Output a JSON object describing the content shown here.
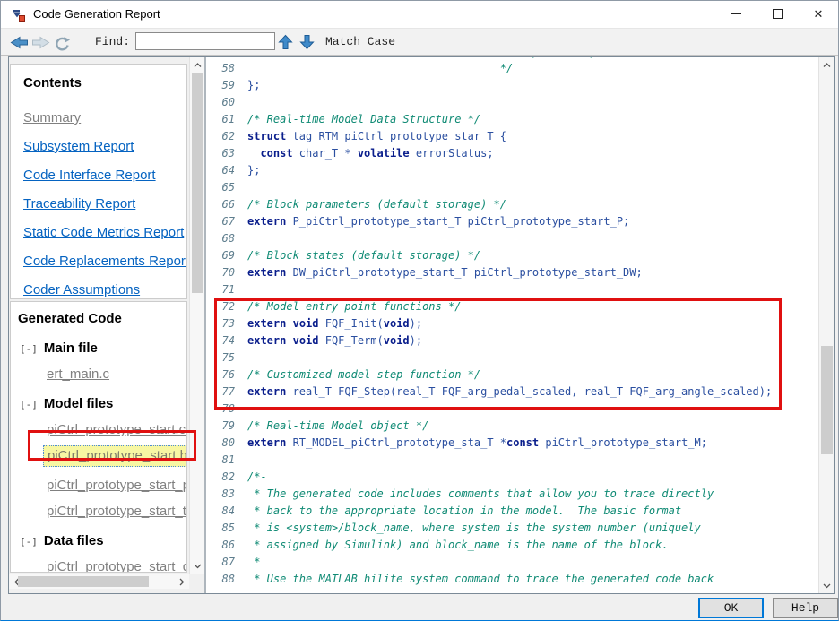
{
  "window": {
    "title": "Code Generation Report"
  },
  "toolbar": {
    "find_label": "Find:",
    "find_value": "",
    "match_case_label": "Match Case"
  },
  "icons": {
    "window_icon": "report-window-icon",
    "back": "back-arrow-icon",
    "forward": "forward-arrow-icon",
    "refresh": "refresh-icon",
    "find_prev": "find-previous-up-arrow-icon",
    "find_next": "find-next-down-arrow-icon",
    "minimize": "minimize-icon",
    "maximize": "maximize-icon",
    "close": "close-icon"
  },
  "sidebar": {
    "contents": {
      "heading": "Contents",
      "links": [
        {
          "label": "Summary",
          "visited": true
        },
        {
          "label": "Subsystem Report",
          "visited": false
        },
        {
          "label": "Code Interface Report",
          "visited": false
        },
        {
          "label": "Traceability Report",
          "visited": false
        },
        {
          "label": "Static Code Metrics Report",
          "visited": false
        },
        {
          "label": "Code Replacements Report",
          "visited": false
        },
        {
          "label": "Coder Assumptions",
          "visited": false
        }
      ]
    },
    "generated_code": {
      "heading": "Generated Code",
      "groups": [
        {
          "expander": "[-]",
          "label": "Main file",
          "files": [
            {
              "label": "ert_main.c",
              "selected": false
            }
          ]
        },
        {
          "expander": "[-]",
          "label": "Model files",
          "files": [
            {
              "label": "piCtrl_prototype_start.c",
              "selected": false
            },
            {
              "label": "piCtrl_prototype_start.h",
              "selected": true,
              "annotated": true
            },
            {
              "label": "piCtrl_prototype_start_pri",
              "selected": false
            },
            {
              "label": "piCtrl_prototype_start_typ",
              "selected": false
            }
          ]
        },
        {
          "expander": "[-]",
          "label": "Data files",
          "files": [
            {
              "label": "piCtrl_prototype_start_da",
              "selected": false
            }
          ]
        }
      ]
    }
  },
  "code": {
    "partial_top_line": "                                            y        y",
    "lines": [
      {
        "n": 58,
        "segments": [
          {
            "s": "c",
            "t": "                                       */"
          }
        ]
      },
      {
        "n": 59,
        "segments": [
          {
            "s": "p",
            "t": "};"
          }
        ]
      },
      {
        "n": 60,
        "segments": []
      },
      {
        "n": 61,
        "segments": [
          {
            "s": "c",
            "t": "/* Real-time Model Data Structure */"
          }
        ]
      },
      {
        "n": 62,
        "segments": [
          {
            "s": "k",
            "t": "struct"
          },
          {
            "s": "p",
            "t": " tag_RTM_piCtrl_prototype_star_T {"
          }
        ]
      },
      {
        "n": 63,
        "segments": [
          {
            "s": "p",
            "t": "  "
          },
          {
            "s": "k",
            "t": "const"
          },
          {
            "s": "p",
            "t": " char_T * "
          },
          {
            "s": "k",
            "t": "volatile"
          },
          {
            "s": "p",
            "t": " errorStatus;"
          }
        ]
      },
      {
        "n": 64,
        "segments": [
          {
            "s": "p",
            "t": "};"
          }
        ]
      },
      {
        "n": 65,
        "segments": []
      },
      {
        "n": 66,
        "segments": [
          {
            "s": "c",
            "t": "/* Block parameters (default storage) */"
          }
        ]
      },
      {
        "n": 67,
        "segments": [
          {
            "s": "k",
            "t": "extern"
          },
          {
            "s": "p",
            "t": " P_piCtrl_prototype_start_T piCtrl_prototype_start_P;"
          }
        ]
      },
      {
        "n": 68,
        "segments": []
      },
      {
        "n": 69,
        "segments": [
          {
            "s": "c",
            "t": "/* Block states (default storage) */"
          }
        ]
      },
      {
        "n": 70,
        "segments": [
          {
            "s": "k",
            "t": "extern"
          },
          {
            "s": "p",
            "t": " DW_piCtrl_prototype_start_T piCtrl_prototype_start_DW;"
          }
        ]
      },
      {
        "n": 71,
        "segments": []
      },
      {
        "n": 72,
        "segments": [
          {
            "s": "c",
            "t": "/* Model entry point functions */"
          }
        ]
      },
      {
        "n": 73,
        "segments": [
          {
            "s": "k",
            "t": "extern"
          },
          {
            "s": "p",
            "t": " "
          },
          {
            "s": "k",
            "t": "void"
          },
          {
            "s": "p",
            "t": " FQF_Init("
          },
          {
            "s": "k",
            "t": "void"
          },
          {
            "s": "p",
            "t": ");"
          }
        ]
      },
      {
        "n": 74,
        "segments": [
          {
            "s": "k",
            "t": "extern"
          },
          {
            "s": "p",
            "t": " "
          },
          {
            "s": "k",
            "t": "void"
          },
          {
            "s": "p",
            "t": " FQF_Term("
          },
          {
            "s": "k",
            "t": "void"
          },
          {
            "s": "p",
            "t": ");"
          }
        ]
      },
      {
        "n": 75,
        "segments": []
      },
      {
        "n": 76,
        "segments": [
          {
            "s": "c",
            "t": "/* Customized model step function */"
          }
        ]
      },
      {
        "n": 77,
        "segments": [
          {
            "s": "k",
            "t": "extern"
          },
          {
            "s": "p",
            "t": " real_T FQF_Step(real_T FQF_arg_pedal_scaled, real_T FQF_arg_angle_scaled);"
          }
        ]
      },
      {
        "n": 78,
        "segments": []
      },
      {
        "n": 79,
        "segments": [
          {
            "s": "c",
            "t": "/* Real-time Model object */"
          }
        ]
      },
      {
        "n": 80,
        "segments": [
          {
            "s": "k",
            "t": "extern"
          },
          {
            "s": "p",
            "t": " RT_MODEL_piCtrl_prototype_sta_T *"
          },
          {
            "s": "k",
            "t": "const"
          },
          {
            "s": "p",
            "t": " piCtrl_prototype_start_M;"
          }
        ]
      },
      {
        "n": 81,
        "segments": []
      },
      {
        "n": 82,
        "segments": [
          {
            "s": "c",
            "t": "/*-"
          }
        ]
      },
      {
        "n": 83,
        "segments": [
          {
            "s": "c",
            "t": " * The generated code includes comments that allow you to trace directly"
          }
        ]
      },
      {
        "n": 84,
        "segments": [
          {
            "s": "c",
            "t": " * back to the appropriate location in the model.  The basic format"
          }
        ]
      },
      {
        "n": 85,
        "segments": [
          {
            "s": "c",
            "t": " * is <system>/block_name, where system is the system number (uniquely"
          }
        ]
      },
      {
        "n": 86,
        "segments": [
          {
            "s": "c",
            "t": " * assigned by Simulink) and block_name is the name of the block."
          }
        ]
      },
      {
        "n": 87,
        "segments": [
          {
            "s": "c",
            "t": " *"
          }
        ]
      },
      {
        "n": 88,
        "segments": [
          {
            "s": "c",
            "t": " * Use the MATLAB hilite system command to trace the generated code back"
          }
        ]
      }
    ]
  },
  "footer": {
    "ok_label": "OK",
    "help_label": "Help"
  },
  "colors": {
    "annotation_red": "#e01010",
    "selection_yellow": "#f7f7a3",
    "link_blue": "#0563c1",
    "visited_gray": "#808080",
    "comment_green": "#0f8a74",
    "keyword_navy": "#0a1e8c",
    "code_blue": "#2b4fa0",
    "accent_blue": "#0078d7"
  }
}
